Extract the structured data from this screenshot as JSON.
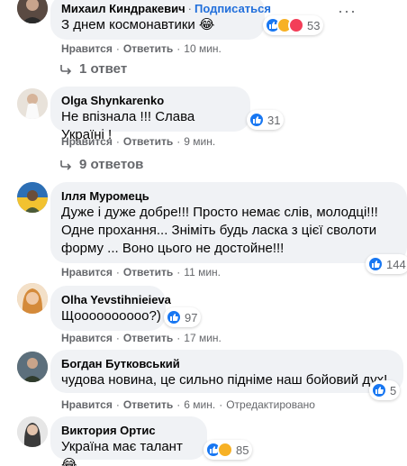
{
  "actions": {
    "like": "Нравится",
    "reply": "Ответить",
    "edited": "Отредактировано"
  },
  "colors": {
    "bubble": "#f0f2f5",
    "secondary_text": "#65676b",
    "accent": "#216fdb",
    "like": "#1877f2",
    "haha": "#f7b125",
    "love": "#f33e58"
  },
  "comments": [
    {
      "author": "Михаил Киндракевич",
      "subscribe": "Подписаться",
      "text": "З днем космонавтики 😂",
      "reactions": [
        "like-icon",
        "haha-icon",
        "love-icon"
      ],
      "reaction_count": "53",
      "time": "10 мин.",
      "replies": "1 ответ"
    },
    {
      "author": "Olga Shynkarenko",
      "text": "Не впізнала !!! Слава Україні !",
      "reactions": [
        "like-icon"
      ],
      "reaction_count": "31",
      "time": "9 мин.",
      "replies": "9 ответов"
    },
    {
      "author": "Ілля Муромець",
      "text_lines": [
        "Дуже і дуже добре!!! Просто немає слів, молодці!!!",
        "Одне прохання... Зніміть будь ласка з цієї сволоти",
        "форму ... Воно цього не достойне!!!"
      ],
      "reactions": [
        "like-icon"
      ],
      "reaction_count": "144",
      "time": "11 мин."
    },
    {
      "author": "Olha Yevstihnieieva",
      "text": "Щоооооооооо?)",
      "reactions": [
        "like-icon"
      ],
      "reaction_count": "97",
      "time": "17 мин."
    },
    {
      "author": "Богдан Бутковський",
      "text": "чудова новина, це сильно підніме наш бойовий дух!",
      "reactions": [
        "like-icon"
      ],
      "reaction_count": "5",
      "time": "6 мин."
    },
    {
      "author": "Виктория Ортис",
      "text": "Україна має талант 😂",
      "reactions": [
        "like-icon",
        "haha-icon"
      ],
      "reaction_count": "85"
    }
  ]
}
